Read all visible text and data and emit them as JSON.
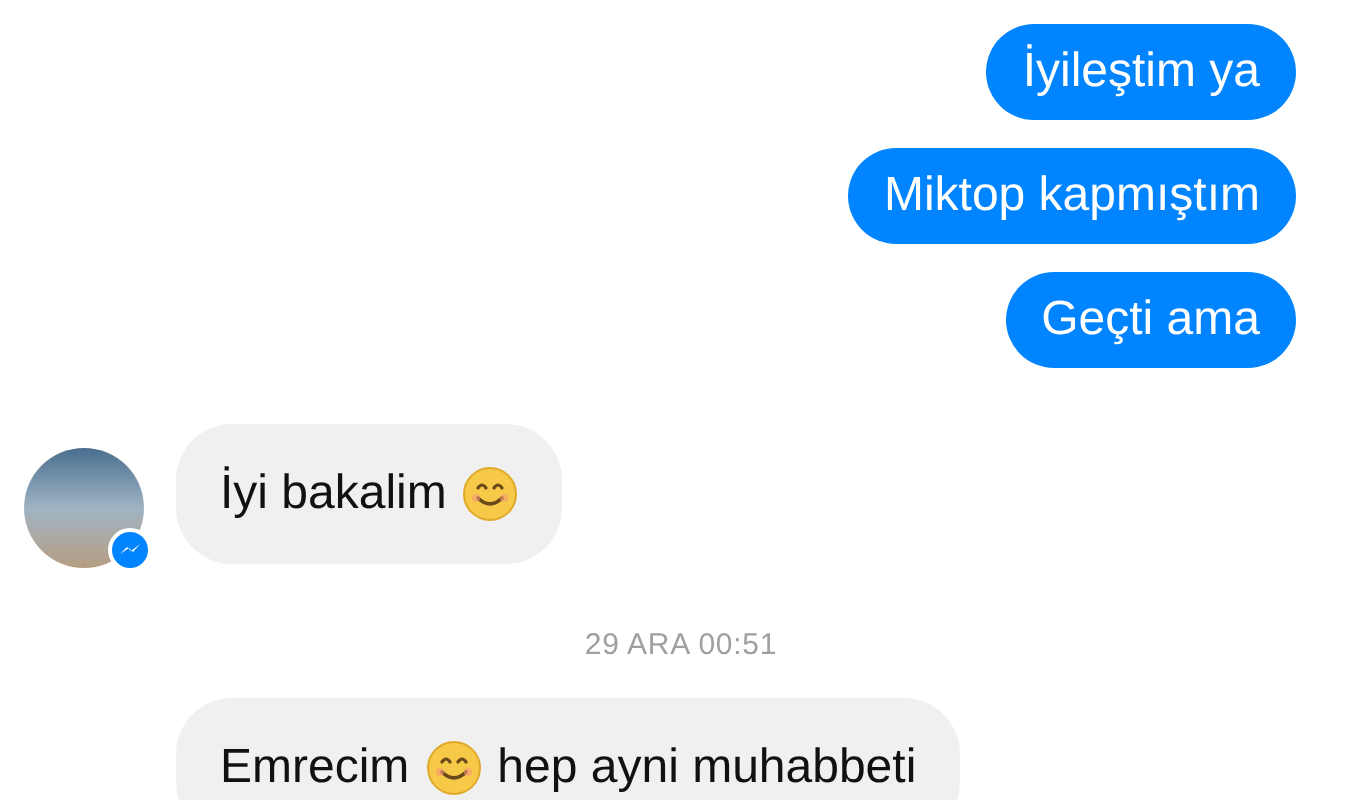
{
  "messages": [
    {
      "kind": "outgoing",
      "parts": [
        {
          "kind": "text",
          "text": "İyileştim ya"
        }
      ]
    },
    {
      "kind": "outgoing",
      "parts": [
        {
          "kind": "text",
          "text": "Miktop kapmıştım"
        }
      ]
    },
    {
      "kind": "outgoing",
      "parts": [
        {
          "kind": "text",
          "text": "Geçti ama"
        }
      ]
    },
    {
      "kind": "incoming",
      "avatar": true,
      "parts": [
        {
          "kind": "text",
          "text": "İyi bakalim"
        },
        {
          "kind": "emoji"
        }
      ]
    },
    {
      "kind": "timestamp",
      "text": "29 ARA 00:51"
    },
    {
      "kind": "incoming",
      "avatar": false,
      "parts": [
        {
          "kind": "text",
          "text": "Emrecim"
        },
        {
          "kind": "emoji"
        },
        {
          "kind": "text",
          "text": "hep ayni muhabbeti"
        }
      ]
    }
  ]
}
